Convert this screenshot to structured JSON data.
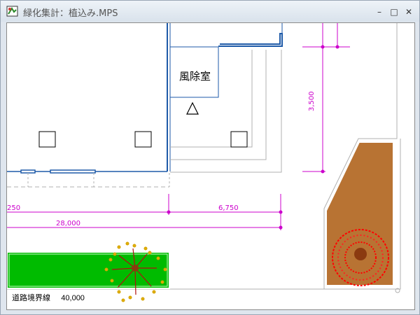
{
  "window": {
    "title": "緑化集計：植込み.MPS",
    "controls": {
      "minimize": "–",
      "maximize": "□",
      "close": "✕"
    }
  },
  "drawing": {
    "room_label": "風除室",
    "dimensions": {
      "d1": "3,500",
      "d2": "6,750",
      "d3": "28,000",
      "d4": "250"
    },
    "boundary_label": "道路境界線",
    "boundary_value": "40,000"
  },
  "colors": {
    "wall": "#1e5aa8",
    "dimension": "#cc00cc",
    "planter_green": "#00bb00",
    "planter_brown": "#b87333",
    "tree_red": "#ff0000",
    "tree_brown": "#8b3a10",
    "tree_yellow": "#d4a000"
  }
}
